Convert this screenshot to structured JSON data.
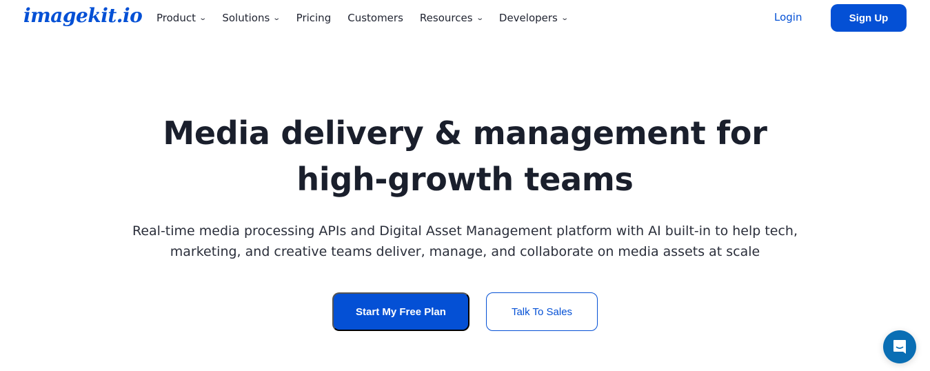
{
  "nav": {
    "logo": "imagekit.io",
    "items": [
      {
        "label": "Product",
        "dropdown": true
      },
      {
        "label": "Solutions",
        "dropdown": true
      },
      {
        "label": "Pricing",
        "dropdown": false
      },
      {
        "label": "Customers",
        "dropdown": false
      },
      {
        "label": "Resources",
        "dropdown": true
      },
      {
        "label": "Developers",
        "dropdown": true
      }
    ],
    "login": "Login",
    "signup": "Sign Up"
  },
  "hero": {
    "title_line1": "Media delivery & management for",
    "title_line2": "high-growth teams",
    "subtitle_line1": "Real-time media processing APIs and Digital Asset Management platform with AI built-in to help tech,",
    "subtitle_line2": "marketing, and creative teams deliver, manage, and collaborate on media assets at scale",
    "primary_cta": "Start My Free Plan",
    "secondary_cta": "Talk To Sales"
  },
  "colors": {
    "brand": "#0450d5",
    "chat": "#0a6eb4"
  },
  "chat": {
    "icon": "chat-bubble-icon"
  }
}
